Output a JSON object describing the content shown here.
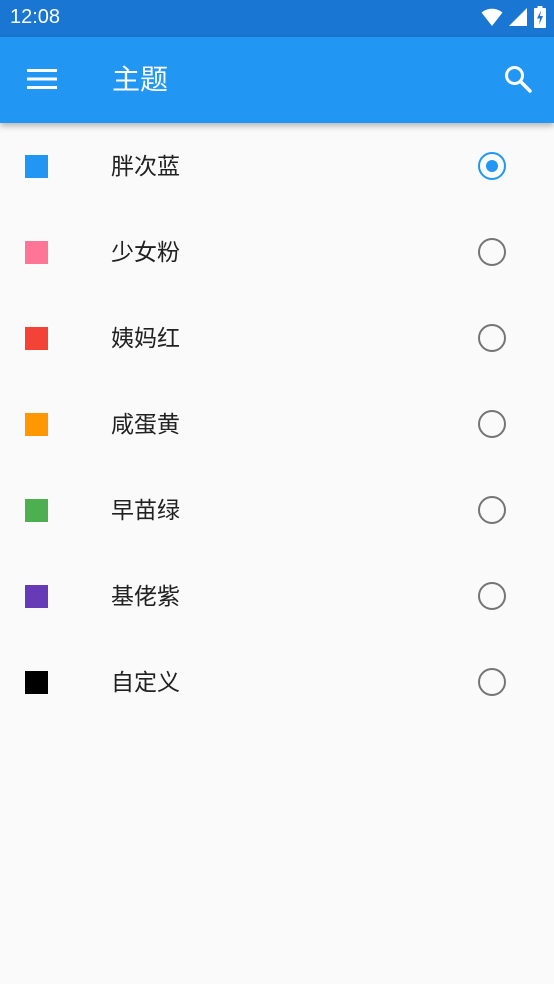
{
  "status_bar": {
    "time": "12:08",
    "icons": [
      "wifi-icon",
      "signal-icon",
      "battery-charging-icon"
    ]
  },
  "app_bar": {
    "title": "主题",
    "left_icon": "menu-icon",
    "right_icon": "search-icon",
    "color": "#2196f3"
  },
  "themes": [
    {
      "label": "胖次蓝",
      "color": "#2196f3",
      "selected": true
    },
    {
      "label": "少女粉",
      "color": "#ff7597",
      "selected": false
    },
    {
      "label": "姨妈红",
      "color": "#f44336",
      "selected": false
    },
    {
      "label": "咸蛋黄",
      "color": "#ff9800",
      "selected": false
    },
    {
      "label": "早苗绿",
      "color": "#4caf50",
      "selected": false
    },
    {
      "label": "基佬紫",
      "color": "#673ab7",
      "selected": false
    },
    {
      "label": "自定义",
      "color": "#000000",
      "selected": false
    }
  ]
}
